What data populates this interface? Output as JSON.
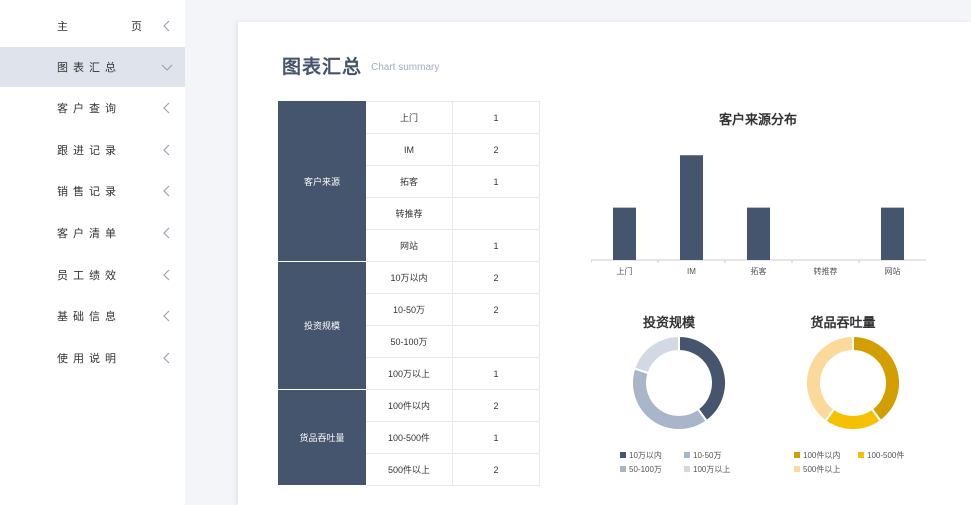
{
  "sidebar": {
    "items": [
      {
        "label": "主页",
        "display": "主 页"
      },
      {
        "label": "图表汇总",
        "display": "图表汇总"
      },
      {
        "label": "客户查询",
        "display": "客户查询"
      },
      {
        "label": "跟进记录",
        "display": "跟进记录"
      },
      {
        "label": "销售记录",
        "display": "销售记录"
      },
      {
        "label": "客户清单",
        "display": "客户清单"
      },
      {
        "label": "员工绩效",
        "display": "员工绩效"
      },
      {
        "label": "基础信息",
        "display": "基础信息"
      },
      {
        "label": "使用说明",
        "display": "使用说明"
      }
    ],
    "active_index": 1
  },
  "header": {
    "title": "图表汇总",
    "subtitle": "Chart summary"
  },
  "table": {
    "groups": [
      {
        "name": "客户来源",
        "rows": [
          {
            "label": "上门",
            "value": "1"
          },
          {
            "label": "IM",
            "value": "2"
          },
          {
            "label": "拓客",
            "value": "1"
          },
          {
            "label": "转推荐",
            "value": ""
          },
          {
            "label": "网站",
            "value": "1"
          }
        ]
      },
      {
        "name": "投资规模",
        "rows": [
          {
            "label": "10万以内",
            "value": "2"
          },
          {
            "label": "10-50万",
            "value": "2"
          },
          {
            "label": "50-100万",
            "value": ""
          },
          {
            "label": "100万以上",
            "value": "1"
          }
        ]
      },
      {
        "name": "货品吞吐量",
        "rows": [
          {
            "label": "100件以内",
            "value": "2"
          },
          {
            "label": "100-500件",
            "value": "1"
          },
          {
            "label": "500件以上",
            "value": "2"
          }
        ]
      }
    ]
  },
  "colors": {
    "sidebar_active": "#dfe3ec",
    "navy": "#44556d",
    "slate": "#a9b5c8",
    "pale": "#d3d9e3",
    "gold": "#d39e00",
    "yellow": "#f5c000",
    "cream": "#fbd99a"
  },
  "chart_data": [
    {
      "type": "bar",
      "title": "客户来源分布",
      "categories": [
        "上门",
        "IM",
        "拓客",
        "转推荐",
        "网站"
      ],
      "values": [
        1,
        2,
        1,
        0,
        1
      ],
      "ylim": [
        0,
        2.1
      ],
      "grid": false,
      "color": "#44556d"
    },
    {
      "type": "pie",
      "title": "投资规模",
      "donut": true,
      "categories": [
        "10万以内",
        "10-50万",
        "50-100万",
        "100万以上"
      ],
      "values": [
        2,
        2,
        0,
        1
      ],
      "colors": [
        "#44556d",
        "#a9b5c8",
        "#a9b5c8",
        "#d3d9e3"
      ],
      "legend_position": "bottom"
    },
    {
      "type": "pie",
      "title": "货品吞吐量",
      "donut": true,
      "categories": [
        "100件以内",
        "100-500件",
        "500件以上"
      ],
      "values": [
        2,
        1,
        2
      ],
      "colors": [
        "#d39e00",
        "#f5c000",
        "#fbd99a"
      ],
      "legend_position": "bottom"
    }
  ]
}
